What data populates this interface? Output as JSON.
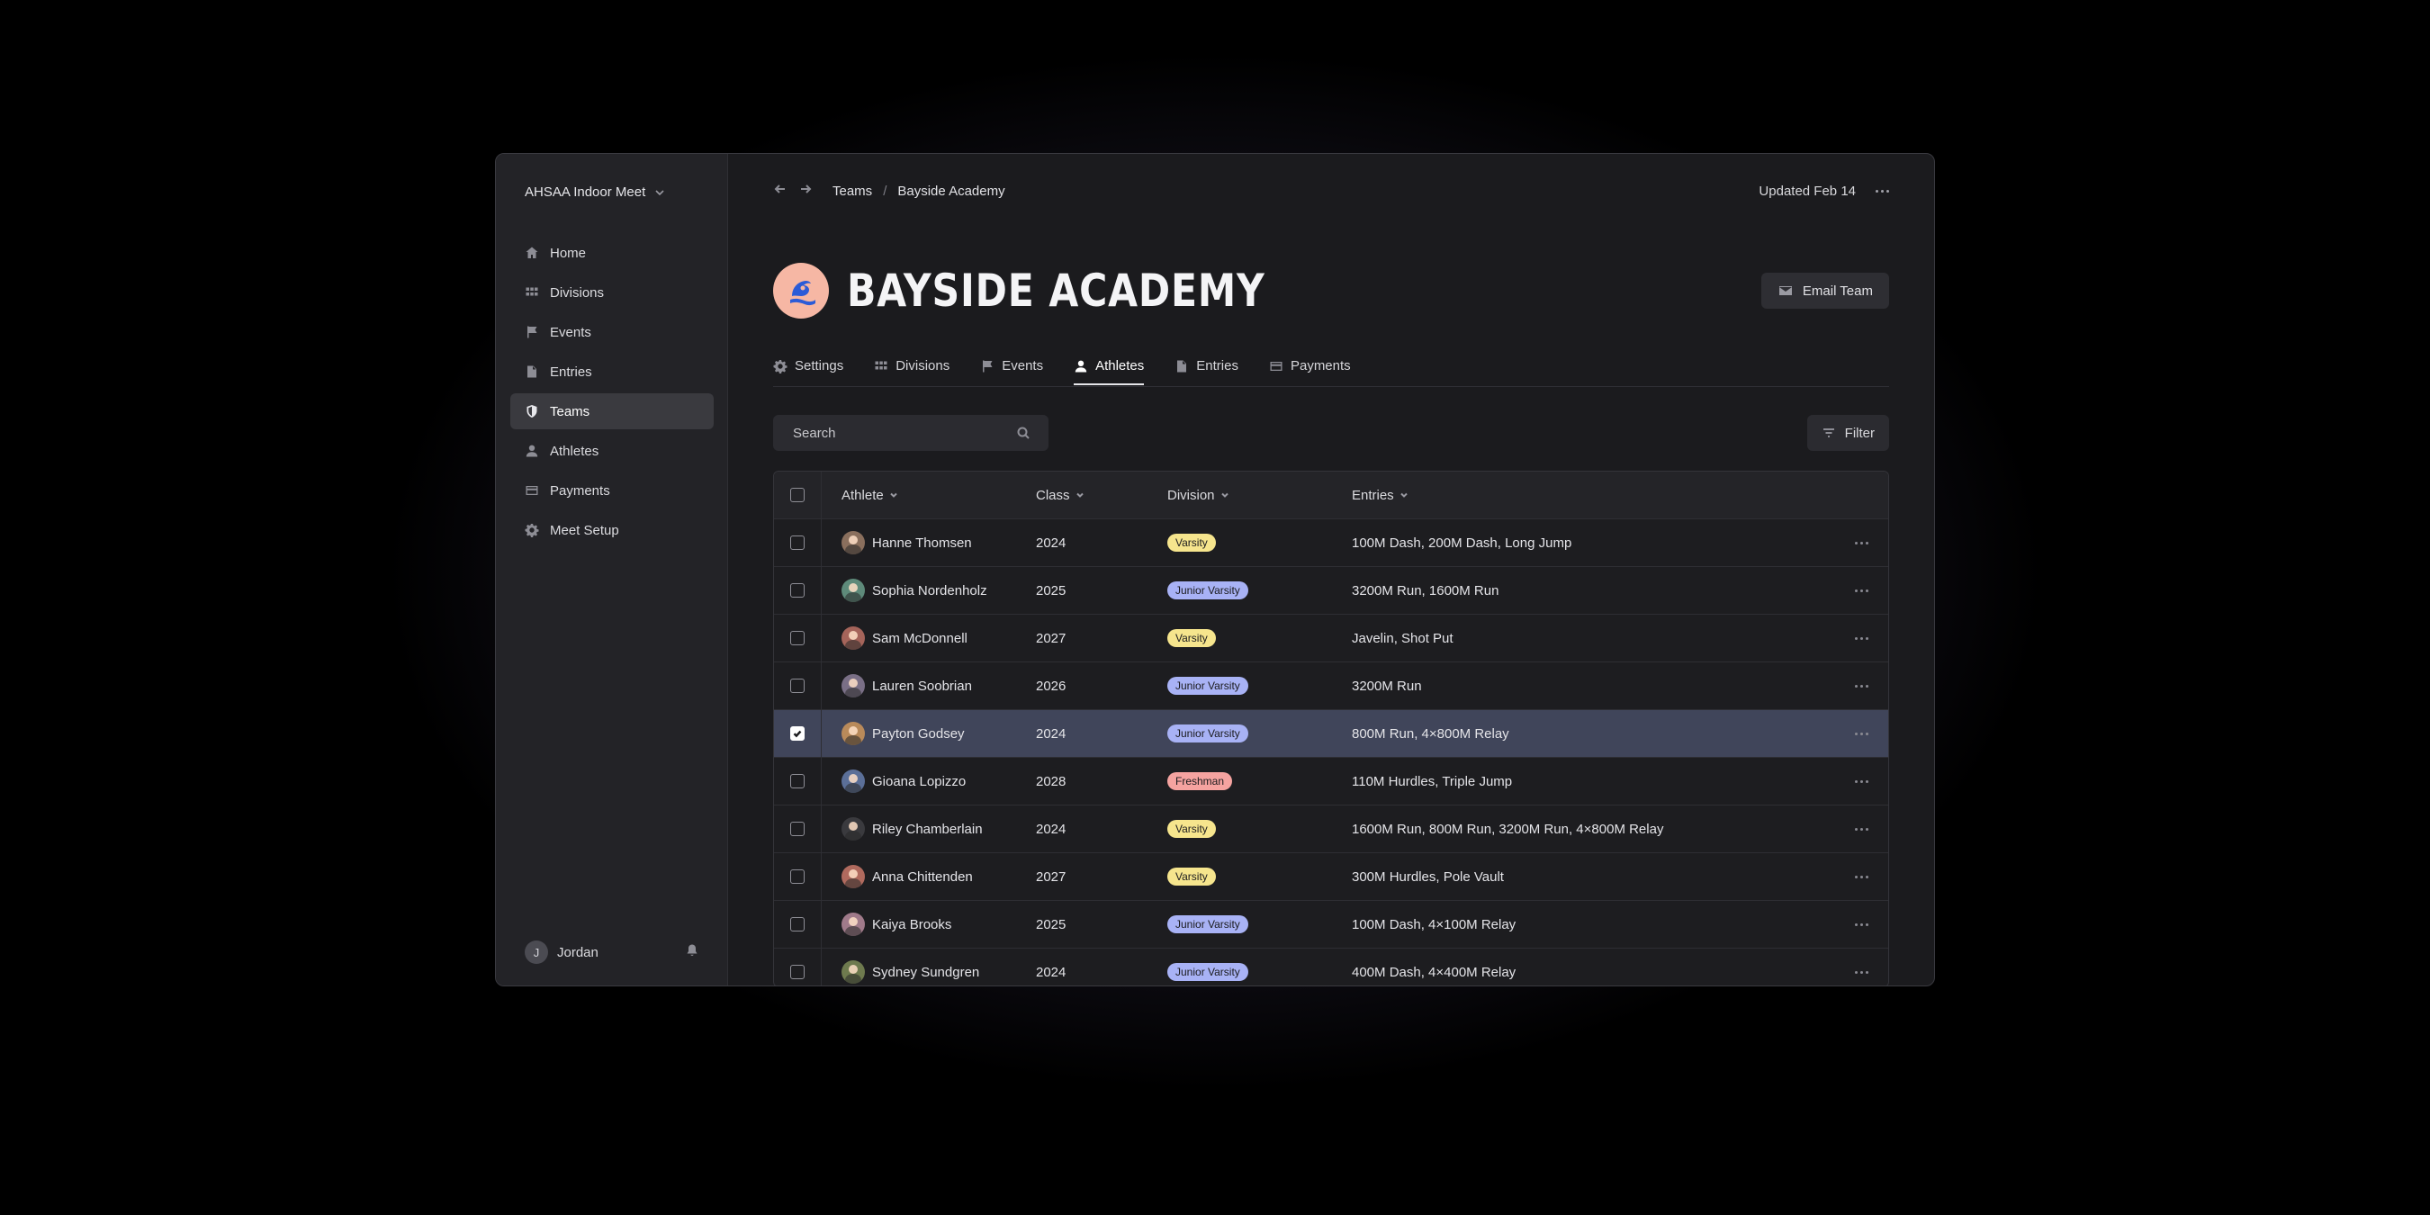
{
  "sidebar": {
    "meet_name": "AHSAA Indoor Meet",
    "items": [
      {
        "label": "Home",
        "icon": "home-icon",
        "active": false
      },
      {
        "label": "Divisions",
        "icon": "grid-icon",
        "active": false
      },
      {
        "label": "Events",
        "icon": "flag-icon",
        "active": false
      },
      {
        "label": "Entries",
        "icon": "document-icon",
        "active": false
      },
      {
        "label": "Teams",
        "icon": "shield-icon",
        "active": true
      },
      {
        "label": "Athletes",
        "icon": "person-icon",
        "active": false
      },
      {
        "label": "Payments",
        "icon": "card-icon",
        "active": false
      },
      {
        "label": "Meet Setup",
        "icon": "gear-icon",
        "active": false
      }
    ],
    "user": {
      "initial": "J",
      "name": "Jordan"
    }
  },
  "topbar": {
    "crumbs": [
      "Teams",
      "Bayside Academy"
    ],
    "crumb_separator": "/",
    "updated": "Updated Feb 14"
  },
  "team": {
    "name": "BAYSIDE ACADEMY",
    "email_label": "Email Team",
    "logo_bg": "#f6b7a4",
    "logo_fg": "#2b5bd7"
  },
  "tabs": [
    {
      "label": "Settings",
      "icon": "gear-icon",
      "active": false
    },
    {
      "label": "Divisions",
      "icon": "grid-icon",
      "active": false
    },
    {
      "label": "Events",
      "icon": "flag-icon",
      "active": false
    },
    {
      "label": "Athletes",
      "icon": "person-icon",
      "active": true
    },
    {
      "label": "Entries",
      "icon": "document-icon",
      "active": false
    },
    {
      "label": "Payments",
      "icon": "card-icon",
      "active": false
    }
  ],
  "search": {
    "placeholder": "Search"
  },
  "filter_label": "Filter",
  "table": {
    "headers": {
      "athlete": "Athlete",
      "class": "Class",
      "division": "Division",
      "entries": "Entries"
    },
    "division_colors": {
      "Varsity": "#f6e58d",
      "Junior Varsity": "#a8b2f5",
      "Freshman": "#f5a3a0"
    },
    "rows": [
      {
        "name": "Hanne Thomsen",
        "class": "2024",
        "division": "Varsity",
        "entries": "100M Dash, 200M Dash, Long Jump",
        "selected": false,
        "avatar": "#8a6f5d"
      },
      {
        "name": "Sophia Nordenholz",
        "class": "2025",
        "division": "Junior Varsity",
        "entries": "3200M Run, 1600M Run",
        "selected": false,
        "avatar": "#5e8a7a"
      },
      {
        "name": "Sam McDonnell",
        "class": "2027",
        "division": "Varsity",
        "entries": "Javelin, Shot Put",
        "selected": false,
        "avatar": "#a5645a"
      },
      {
        "name": "Lauren Soobrian",
        "class": "2026",
        "division": "Junior Varsity",
        "entries": "3200M Run",
        "selected": false,
        "avatar": "#7a6f86"
      },
      {
        "name": "Payton Godsey",
        "class": "2024",
        "division": "Junior Varsity",
        "entries": "800M Run, 4×800M Relay",
        "selected": true,
        "avatar": "#b98a5a"
      },
      {
        "name": "Gioana Lopizzo",
        "class": "2028",
        "division": "Freshman",
        "entries": "110M Hurdles, Triple Jump",
        "selected": false,
        "avatar": "#5b6f98"
      },
      {
        "name": "Riley Chamberlain",
        "class": "2024",
        "division": "Varsity",
        "entries": "1600M Run, 800M Run, 3200M Run, 4×800M Relay",
        "selected": false,
        "avatar": "#3a3a3e"
      },
      {
        "name": "Anna Chittenden",
        "class": "2027",
        "division": "Varsity",
        "entries": "300M Hurdles, Pole Vault",
        "selected": false,
        "avatar": "#b06a5e"
      },
      {
        "name": "Kaiya Brooks",
        "class": "2025",
        "division": "Junior Varsity",
        "entries": "100M Dash, 4×100M Relay",
        "selected": false,
        "avatar": "#a07a8a"
      },
      {
        "name": "Sydney Sundgren",
        "class": "2024",
        "division": "Junior Varsity",
        "entries": "400M Dash, 4×400M Relay",
        "selected": false,
        "avatar": "#6e7a4e"
      }
    ]
  }
}
